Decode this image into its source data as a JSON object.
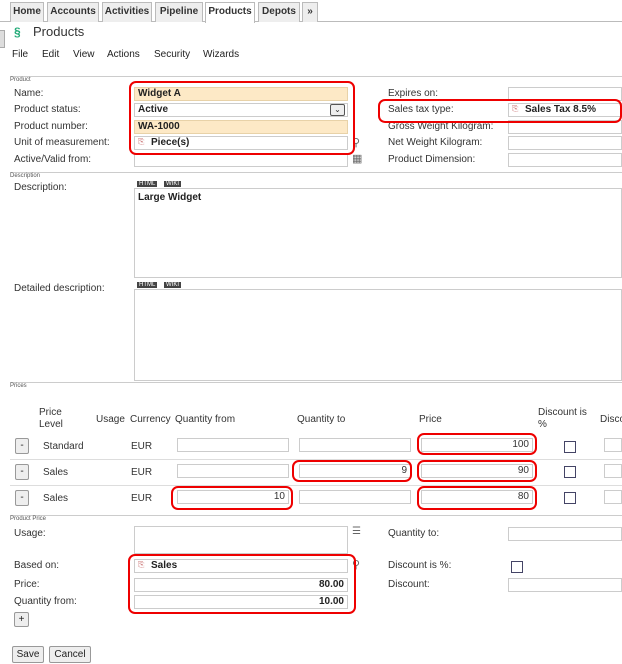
{
  "tabs": [
    "Home",
    "Accounts",
    "Activities",
    "Pipeline",
    "Products",
    "Depots",
    "»"
  ],
  "title": "Products",
  "menu": [
    "File",
    "Edit",
    "View",
    "Actions",
    "Security",
    "Wizards"
  ],
  "sections": {
    "product": "Product",
    "description": "Description",
    "prices": "Prices",
    "product_price": "Product Price"
  },
  "product": {
    "name_label": "Name:",
    "name": "Widget A",
    "status_label": "Product status:",
    "status": "Active",
    "number_label": "Product number:",
    "number": "WA-1000",
    "uom_label": "Unit of measurement:",
    "uom": "Piece(s)",
    "valid_label": "Active/Valid from:",
    "expires_label": "Expires on:",
    "tax_label": "Sales tax type:",
    "tax": "Sales Tax 8.5%",
    "gross_label": "Gross Weight Kilogram:",
    "net_label": "Net Weight Kilogram:",
    "dim_label": "Product Dimension:"
  },
  "description": {
    "desc_label": "Description:",
    "desc": "Large Widget",
    "detailed_label": "Detailed description:",
    "html_tag": "HTML",
    "wiki_tag": "WIKI"
  },
  "prices": {
    "headers": {
      "level": "Price Level",
      "usage": "Usage",
      "currency": "Currency",
      "qty_from": "Quantity from",
      "qty_to": "Quantity to",
      "price": "Price",
      "disc_pct": "Discount is %",
      "disc": "Disco"
    },
    "rows": [
      {
        "btn": "-",
        "level": "Standard",
        "currency": "EUR",
        "qty_from": "",
        "qty_to": "",
        "price": "100"
      },
      {
        "btn": "-",
        "level": "Sales",
        "currency": "EUR",
        "qty_from": "",
        "qty_to": "9",
        "price": "90"
      },
      {
        "btn": "-",
        "level": "Sales",
        "currency": "EUR",
        "qty_from": "10",
        "qty_to": "",
        "price": "80"
      }
    ]
  },
  "product_price": {
    "usage_label": "Usage:",
    "based_label": "Based on:",
    "based": "Sales",
    "price_label": "Price:",
    "price": "80.00",
    "qty_from_label": "Quantity from:",
    "qty_from": "10.00",
    "qty_to_label": "Quantity to:",
    "disc_pct_label": "Discount is %:",
    "disc_label": "Discount:",
    "add_btn": "+"
  },
  "buttons": {
    "save": "Save",
    "cancel": "Cancel"
  },
  "colors": {
    "highlight": "#e00000",
    "required_field": "#fde9c6"
  }
}
